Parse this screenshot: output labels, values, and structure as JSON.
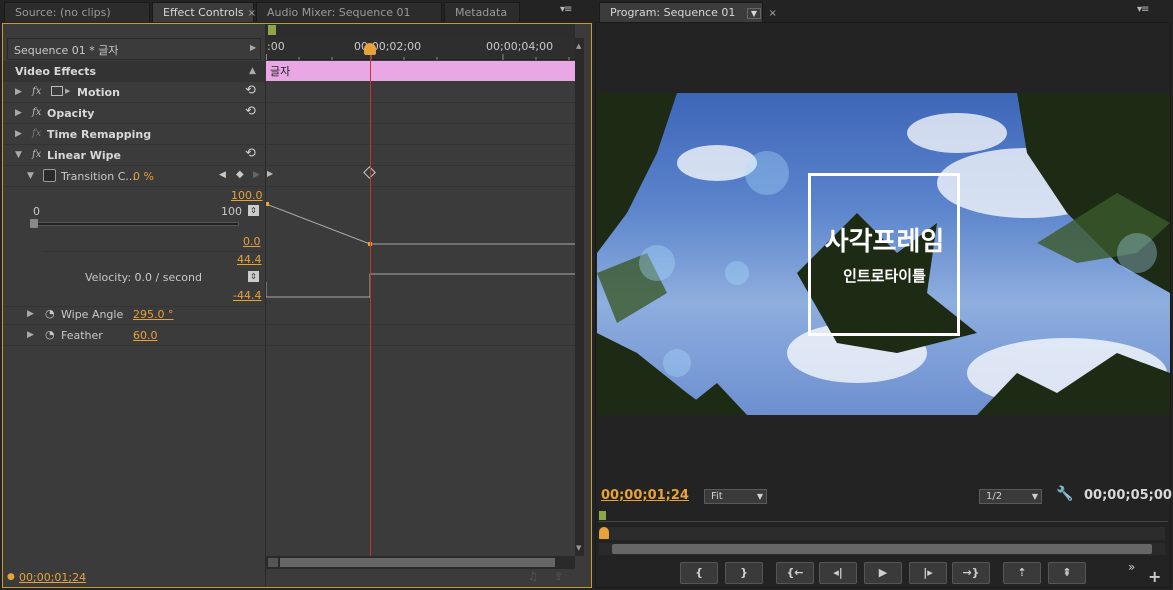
{
  "tabs_left": [
    {
      "label": "Source: (no clips)"
    },
    {
      "label": "Effect Controls",
      "active": true
    },
    {
      "label": "Audio Mixer: Sequence 01"
    },
    {
      "label": "Metadata"
    }
  ],
  "tab_close": "×",
  "panel_menu_glyph": "▾≡",
  "program_tab": {
    "label": "Program: Sequence 01"
  },
  "effect_controls": {
    "sequence_label": "Sequence 01 * 글자",
    "section_title": "Video Effects",
    "effects": [
      {
        "name": "Motion"
      },
      {
        "name": "Opacity"
      },
      {
        "name": "Time Remapping"
      },
      {
        "name": "Linear Wipe"
      }
    ],
    "transition_completion": {
      "label": "Transition C...",
      "value": "0 %"
    },
    "graph": {
      "max": "100.0",
      "min_label": "0",
      "max_label": "100",
      "min": "0.0",
      "vel_max": "44.4",
      "vel_min": "-44.4",
      "velocity_label": "Velocity: 0.0 / second"
    },
    "wipe_angle": {
      "label": "Wipe Angle",
      "value": "295.0 °"
    },
    "feather": {
      "label": "Feather",
      "value": "60.0"
    },
    "timecode": "00;00;01;24"
  },
  "timeline": {
    "ruler": [
      ":00",
      "00;00;02;00",
      "00;00;04;00"
    ],
    "clip_label": "글자",
    "clip_color": "#e9a7e6",
    "playhead_color": "#c0392b"
  },
  "program": {
    "title_main": "사각프레임",
    "title_sub": "인트로타이틀",
    "timecode": "00;00;01;24",
    "fit": "Fit",
    "resolution": "1/2",
    "duration": "00;00;05;00"
  },
  "transport": [
    {
      "name": "mark-in",
      "glyph": "{"
    },
    {
      "name": "mark-out",
      "glyph": "}"
    },
    {
      "name": "go-to-in",
      "glyph": "{←"
    },
    {
      "name": "step-back",
      "glyph": "◂|"
    },
    {
      "name": "play",
      "glyph": "▶"
    },
    {
      "name": "step-forward",
      "glyph": "|▸"
    },
    {
      "name": "go-to-out",
      "glyph": "→}"
    },
    {
      "name": "lift",
      "glyph": "⇡"
    },
    {
      "name": "extract",
      "glyph": "⇞"
    }
  ],
  "extras_glyph": "»",
  "add_glyph": "+"
}
